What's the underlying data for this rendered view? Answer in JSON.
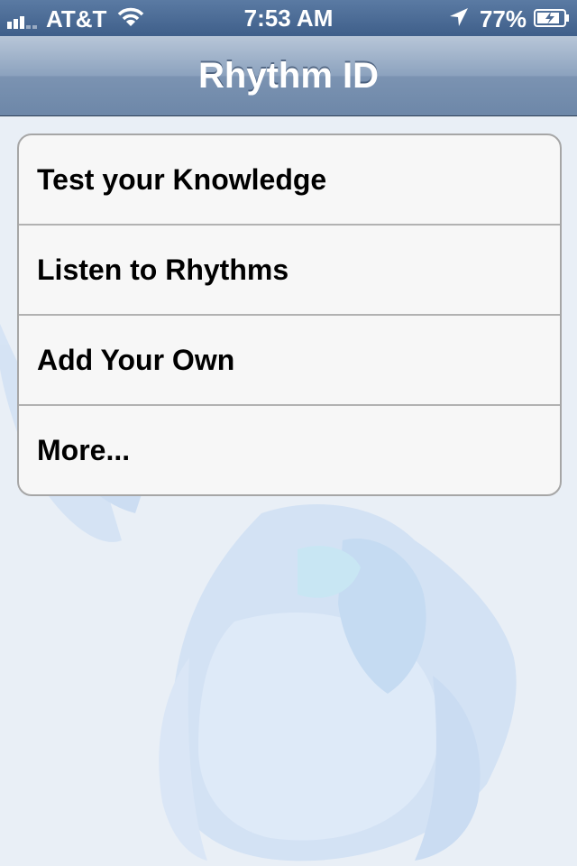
{
  "status_bar": {
    "carrier": "AT&T",
    "time": "7:53 AM",
    "battery": "77%",
    "icons": [
      "signal-icon",
      "wifi-icon",
      "location-icon",
      "battery-icon"
    ]
  },
  "nav": {
    "title": "Rhythm ID"
  },
  "menu": {
    "items": [
      {
        "label": "Test your Knowledge"
      },
      {
        "label": "Listen to Rhythms"
      },
      {
        "label": "Add Your Own"
      },
      {
        "label": "More..."
      }
    ]
  },
  "colors": {
    "nav_bar": "#7b93b2",
    "status_bar": "#3f5f8a",
    "background": "#e9eff6",
    "watermark": "#bcd3f2"
  }
}
